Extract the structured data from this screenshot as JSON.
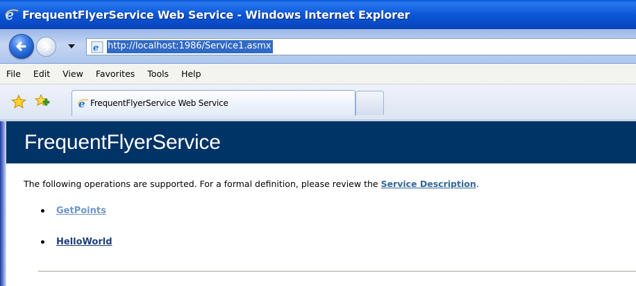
{
  "window": {
    "title": "FrequentFlyerService Web Service - Windows Internet Explorer"
  },
  "address_bar": {
    "url": "http://localhost:1986/Service1.asmx"
  },
  "menu": {
    "items": [
      "File",
      "Edit",
      "View",
      "Favorites",
      "Tools",
      "Help"
    ]
  },
  "tabs": [
    {
      "label": "FrequentFlyerService Web Service",
      "active": true
    }
  ],
  "page": {
    "heading": "FrequentFlyerService",
    "intro_text": "The following operations are supported. For a formal definition, please review the ",
    "service_description_link": "Service Description",
    "intro_suffix": ".",
    "operations": [
      {
        "label": "GetPoints",
        "visited": true
      },
      {
        "label": "HelloWorld",
        "visited": false
      }
    ]
  },
  "colors": {
    "header_bg": "#003366",
    "link": "#336699",
    "visited_link": "#6e95c8",
    "url_highlight": "#316ac5"
  },
  "icons": {
    "titlebar": "ie-logo-icon",
    "back": "back-arrow-icon",
    "forward": "forward-arrow-icon",
    "address_page": "ie-page-icon",
    "favorites": "favorites-star-icon",
    "add_favorite": "add-favorite-icon",
    "tab": "ie-page-icon"
  }
}
